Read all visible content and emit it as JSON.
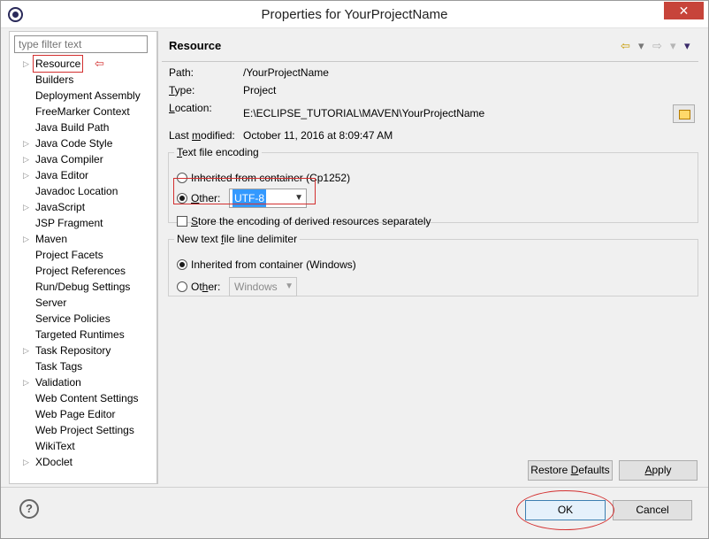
{
  "window": {
    "title": "Properties for YourProjectName",
    "close_label": "✕"
  },
  "filter": {
    "placeholder": "type filter text"
  },
  "tree": {
    "items": [
      {
        "label": "Resource",
        "expandable": true,
        "selected": true
      },
      {
        "label": "Builders",
        "expandable": false
      },
      {
        "label": "Deployment Assembly",
        "expandable": false
      },
      {
        "label": "FreeMarker Context",
        "expandable": false
      },
      {
        "label": "Java Build Path",
        "expandable": false
      },
      {
        "label": "Java Code Style",
        "expandable": true
      },
      {
        "label": "Java Compiler",
        "expandable": true
      },
      {
        "label": "Java Editor",
        "expandable": true
      },
      {
        "label": "Javadoc Location",
        "expandable": false
      },
      {
        "label": "JavaScript",
        "expandable": true
      },
      {
        "label": "JSP Fragment",
        "expandable": false
      },
      {
        "label": "Maven",
        "expandable": true
      },
      {
        "label": "Project Facets",
        "expandable": false
      },
      {
        "label": "Project References",
        "expandable": false
      },
      {
        "label": "Run/Debug Settings",
        "expandable": false
      },
      {
        "label": "Server",
        "expandable": false
      },
      {
        "label": "Service Policies",
        "expandable": false
      },
      {
        "label": "Targeted Runtimes",
        "expandable": false
      },
      {
        "label": "Task Repository",
        "expandable": true
      },
      {
        "label": "Task Tags",
        "expandable": false
      },
      {
        "label": "Validation",
        "expandable": true
      },
      {
        "label": "Web Content Settings",
        "expandable": false
      },
      {
        "label": "Web Page Editor",
        "expandable": false
      },
      {
        "label": "Web Project Settings",
        "expandable": false
      },
      {
        "label": "WikiText",
        "expandable": false
      },
      {
        "label": "XDoclet",
        "expandable": true
      }
    ]
  },
  "page": {
    "title": "Resource",
    "path": {
      "label": "Path:",
      "value": "/YourProjectName"
    },
    "type": {
      "label_pre": "",
      "label_u": "T",
      "label_post": "ype:",
      "value": "Project"
    },
    "location": {
      "label_pre": "",
      "label_u": "L",
      "label_post": "ocation:",
      "value": "E:\\ECLIPSE_TUTORIAL\\MAVEN\\YourProjectName"
    },
    "last_modified": {
      "label_pre": "Last ",
      "label_u": "m",
      "label_post": "odified:",
      "value": "October 11, 2016 at 8:09:47 AM"
    }
  },
  "encoding": {
    "legend_pre": "",
    "legend_u": "T",
    "legend_post": "ext file encoding",
    "inherited_label": "Inherited from container (Cp1252)",
    "other_label_pre": "",
    "other_label_u": "O",
    "other_label_post": "ther:",
    "other_value": "UTF-8",
    "store_label_pre": "",
    "store_label_u": "S",
    "store_label_post": "tore the encoding of derived resources separately"
  },
  "delimiter": {
    "legend_pre": "New text ",
    "legend_u": "f",
    "legend_post": "ile line delimiter",
    "inherited_label": "Inherited from container (Windows)",
    "other_label_pre": "Ot",
    "other_label_u": "h",
    "other_label_post": "er:",
    "other_value": "Windows"
  },
  "buttons": {
    "restore_pre": "Restore ",
    "restore_u": "D",
    "restore_post": "efaults",
    "apply_pre": "",
    "apply_u": "A",
    "apply_post": "pply",
    "ok": "OK",
    "cancel": "Cancel",
    "help": "?"
  },
  "icons": {
    "back": "⇦",
    "forward": "⇨",
    "dropdown": "▾",
    "menu": "▾",
    "annotation_arrow": "⇦"
  },
  "colors": {
    "annotation": "#d32f2f",
    "selection": "#3399ff"
  }
}
